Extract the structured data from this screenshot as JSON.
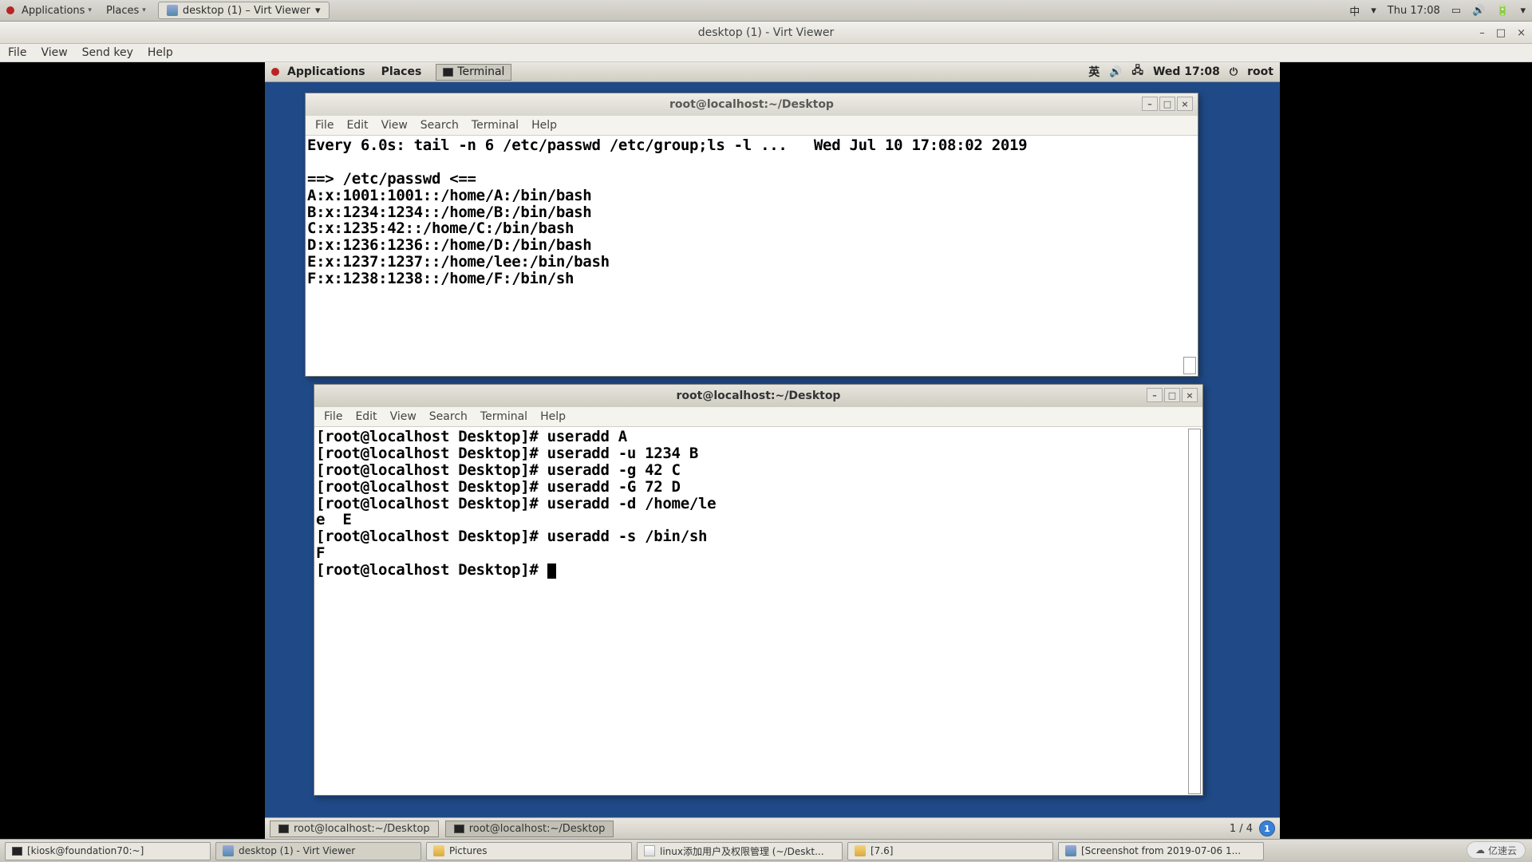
{
  "host_panel": {
    "applications": "Applications",
    "places": "Places",
    "task_label": "desktop (1) – Virt Viewer",
    "input_method": "中",
    "clock": "Thu 17:08"
  },
  "virt_viewer": {
    "title": "desktop (1) - Virt Viewer",
    "menu": {
      "file": "File",
      "view": "View",
      "sendkey": "Send key",
      "help": "Help"
    }
  },
  "guest_panel": {
    "applications": "Applications",
    "places": "Places",
    "taskbtn": "Terminal",
    "ime": "英",
    "clock": "Wed 17:08",
    "user": "root"
  },
  "term1": {
    "title": "root@localhost:~/Desktop",
    "menu": {
      "file": "File",
      "edit": "Edit",
      "view": "View",
      "search": "Search",
      "terminal": "Terminal",
      "help": "Help"
    },
    "lines": [
      "Every 6.0s: tail -n 6 /etc/passwd /etc/group;ls -l ...   Wed Jul 10 17:08:02 2019",
      "",
      "==> /etc/passwd <==",
      "A:x:1001:1001::/home/A:/bin/bash",
      "B:x:1234:1234::/home/B:/bin/bash",
      "C:x:1235:42::/home/C:/bin/bash",
      "D:x:1236:1236::/home/D:/bin/bash",
      "E:x:1237:1237::/home/lee:/bin/bash",
      "F:x:1238:1238::/home/F:/bin/sh"
    ]
  },
  "term2": {
    "title": "root@localhost:~/Desktop",
    "menu": {
      "file": "File",
      "edit": "Edit",
      "view": "View",
      "search": "Search",
      "terminal": "Terminal",
      "help": "Help"
    },
    "lines": [
      "[root@localhost Desktop]# useradd A",
      "[root@localhost Desktop]# useradd -u 1234 B",
      "[root@localhost Desktop]# useradd -g 42 C",
      "[root@localhost Desktop]# useradd -G 72 D",
      "[root@localhost Desktop]# useradd -d /home/le",
      "e  E",
      "[root@localhost Desktop]# useradd -s /bin/sh",
      "F",
      "[root@localhost Desktop]# "
    ]
  },
  "guest_taskbar": {
    "btn1": "root@localhost:~/Desktop",
    "btn2": "root@localhost:~/Desktop",
    "workspace": "1 / 4",
    "ws_badge": "1"
  },
  "host_taskbar": {
    "t1": "[kiosk@foundation70:~]",
    "t2": "desktop (1) - Virt Viewer",
    "t3": "Pictures",
    "t4": "linux添加用户及权限管理 (~/Deskt...",
    "t5": "[7.6]",
    "t6": "[Screenshot from 2019-07-06 1..."
  },
  "logo": "亿速云"
}
